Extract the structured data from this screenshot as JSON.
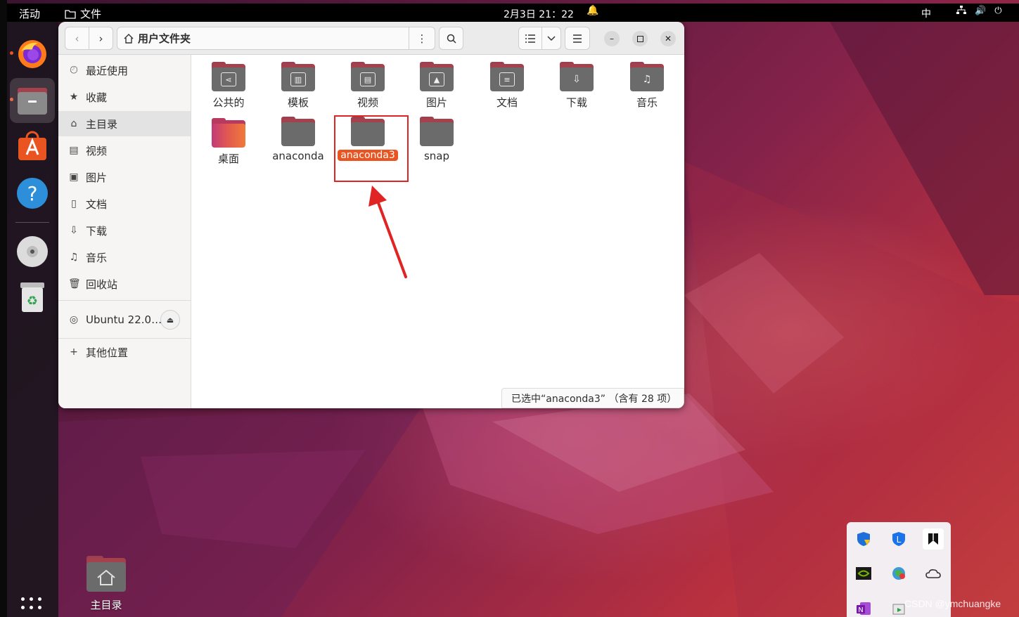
{
  "topbar": {
    "activities": "活动",
    "app_name": "文件",
    "clock": "2月3日 21：22",
    "input_method": "中"
  },
  "window": {
    "path_title": "用户文件夹",
    "status_text": "已选中“anaconda3” （含有 28 项）"
  },
  "sidebar": {
    "items": [
      {
        "label": "最近使用",
        "icon": "clock-icon"
      },
      {
        "label": "收藏",
        "icon": "star-icon"
      },
      {
        "label": "主目录",
        "icon": "home-icon"
      },
      {
        "label": "视频",
        "icon": "film-icon"
      },
      {
        "label": "图片",
        "icon": "image-icon"
      },
      {
        "label": "文档",
        "icon": "document-icon"
      },
      {
        "label": "下载",
        "icon": "download-icon"
      },
      {
        "label": "音乐",
        "icon": "music-icon"
      },
      {
        "label": "回收站",
        "icon": "trash-icon"
      }
    ],
    "device": "Ubuntu 22.0…",
    "other_locations": "其他位置"
  },
  "files": [
    {
      "label": "公共的",
      "icon": "share-icon"
    },
    {
      "label": "模板",
      "icon": "template-icon"
    },
    {
      "label": "视频",
      "icon": "film-icon"
    },
    {
      "label": "图片",
      "icon": "image-icon"
    },
    {
      "label": "文档",
      "icon": "document-icon"
    },
    {
      "label": "下载",
      "icon": "download-icon"
    },
    {
      "label": "音乐",
      "icon": "music-icon"
    },
    {
      "label": "桌面",
      "icon": "desktop-icon"
    },
    {
      "label": "anaconda",
      "icon": "folder-icon"
    },
    {
      "label": "anaconda3",
      "icon": "folder-icon",
      "selected": true
    },
    {
      "label": "snap",
      "icon": "folder-icon"
    }
  ],
  "desktop": {
    "home_label": "主目录"
  },
  "watermark": "CSDN @ymchuangke",
  "colors": {
    "accent": "#e95420",
    "annotation": "#e02424"
  }
}
